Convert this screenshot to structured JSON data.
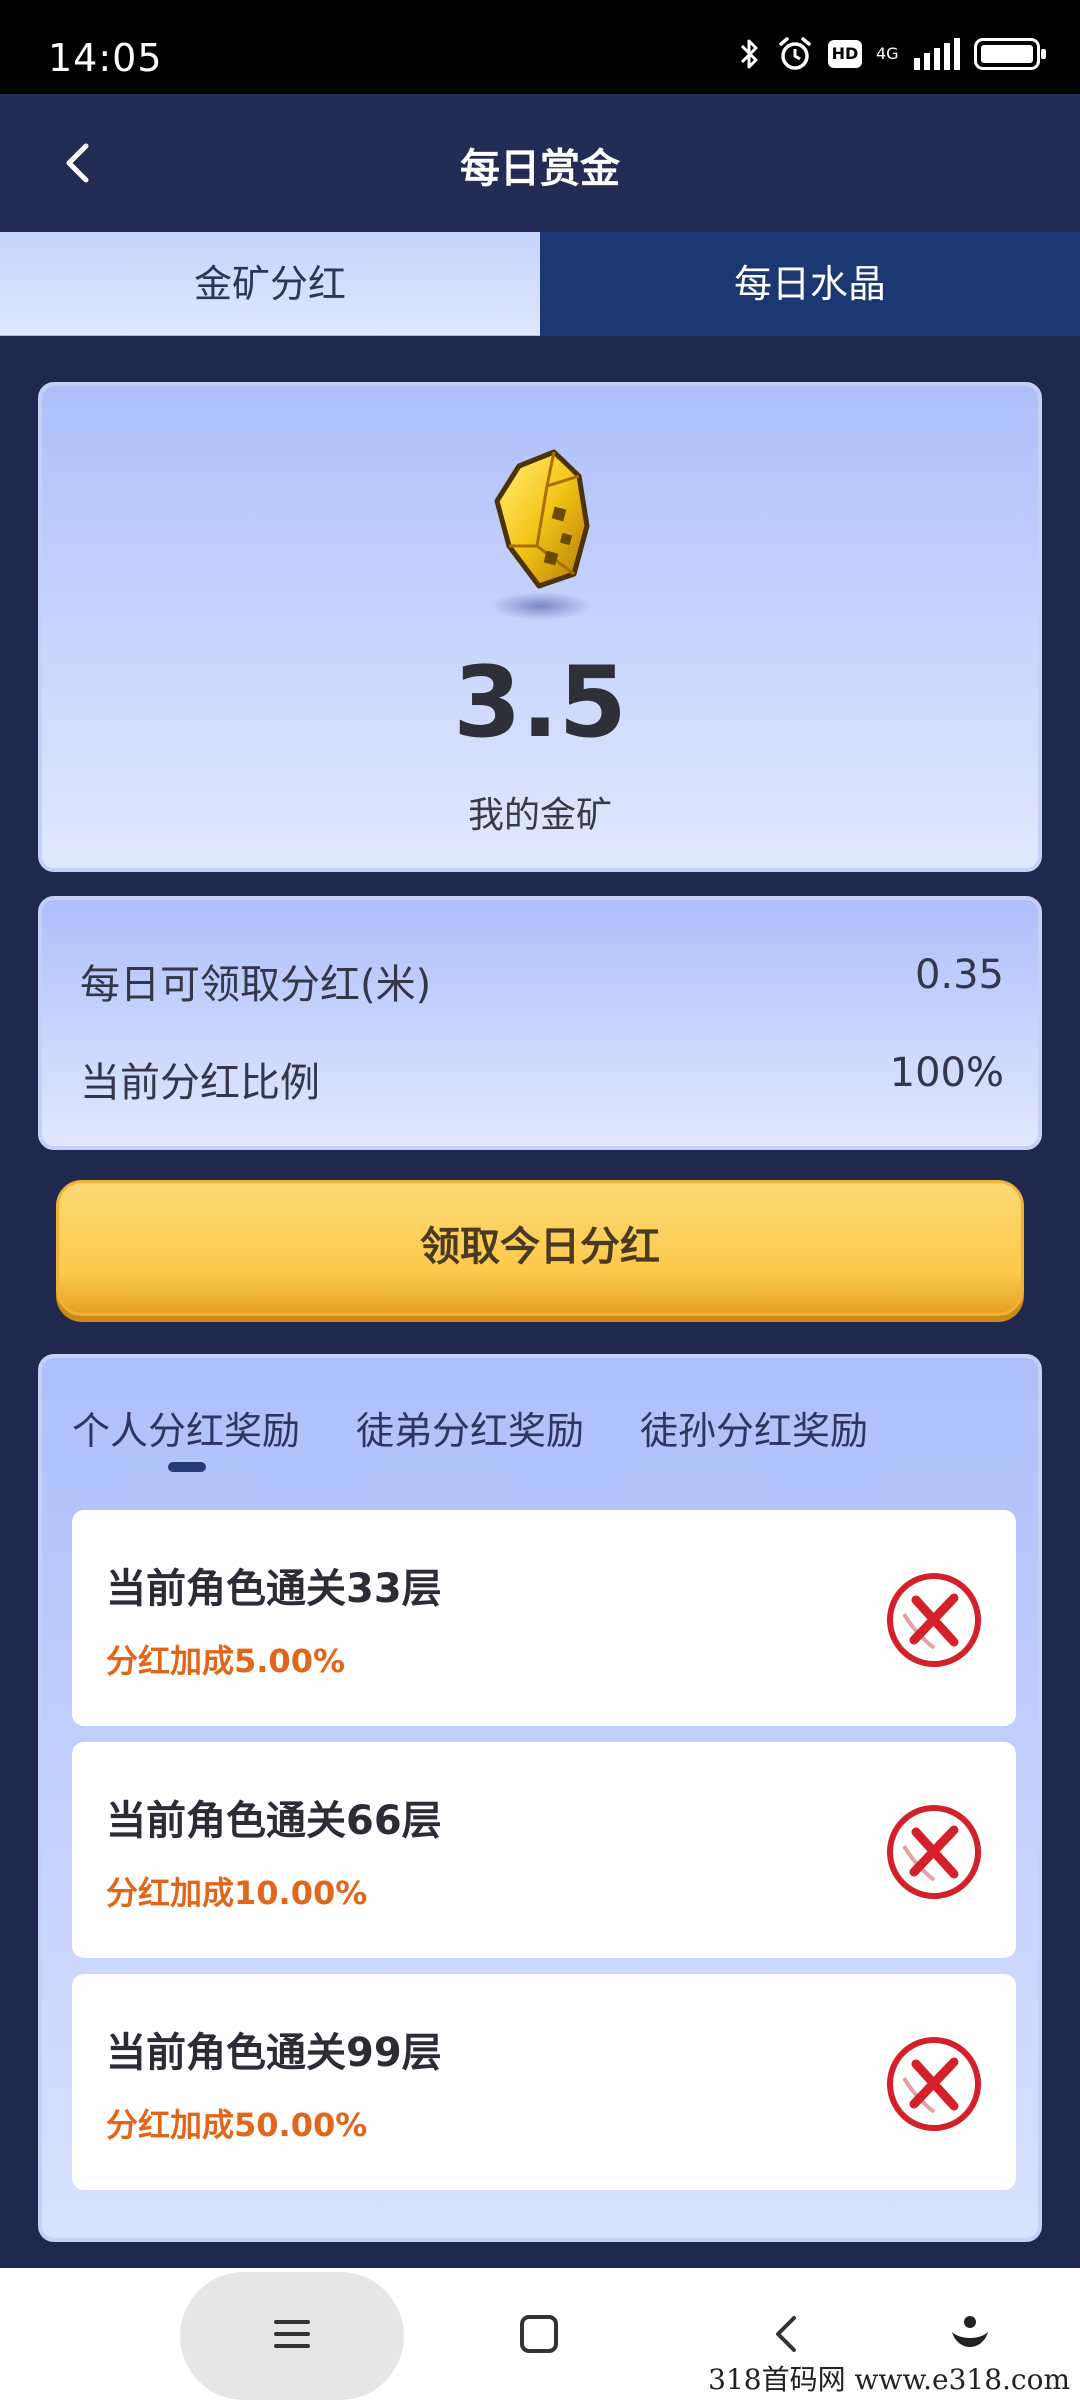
{
  "status_bar": {
    "time": "14:05",
    "hd_label": "HD",
    "network_label": "4G"
  },
  "header": {
    "title": "每日赏金"
  },
  "top_tabs": [
    {
      "label": "金矿分红",
      "active": true
    },
    {
      "label": "每日水晶",
      "active": false
    }
  ],
  "gold_card": {
    "icon": "gold-nugget-icon",
    "value": "3.5",
    "label": "我的金矿"
  },
  "info": {
    "daily_dividend_label": "每日可领取分红(米)",
    "daily_dividend_value": "0.35",
    "ratio_label": "当前分红比例",
    "ratio_value": "100%"
  },
  "claim_button": {
    "label": "领取今日分红"
  },
  "reward_tabs": [
    {
      "label": "个人分红奖励",
      "active": true
    },
    {
      "label": "徒弟分红奖励",
      "active": false
    },
    {
      "label": "徒孙分红奖励",
      "active": false
    }
  ],
  "rewards": [
    {
      "title": "当前角色通关33层",
      "bonus": "分红加成5.00%",
      "status_icon": "not-completed-x-icon"
    },
    {
      "title": "当前角色通关66层",
      "bonus": "分红加成10.00%",
      "status_icon": "not-completed-x-icon"
    },
    {
      "title": "当前角色通关99层",
      "bonus": "分红加成50.00%",
      "status_icon": "not-completed-x-icon"
    }
  ],
  "watermark": "318首码网  www.e318.com",
  "colors": {
    "header_bg": "#222c54",
    "active_tab_bg": "#dfe7fd",
    "inactive_tab_bg": "#1b3873",
    "button_gold": "#fbc94a",
    "bonus_orange": "#e0661b",
    "status_red": "#d3202a"
  }
}
